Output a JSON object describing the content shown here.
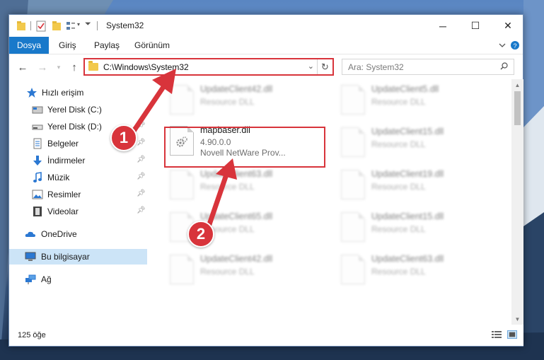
{
  "window": {
    "title": "System32",
    "controls": {
      "minimize": "─",
      "maximize": "☐",
      "close": "✕"
    }
  },
  "ribbon": {
    "tabs": [
      "Dosya",
      "Giriş",
      "Paylaş",
      "Görünüm"
    ],
    "expand_icon": "chevron-down-icon",
    "help_icon": "help-icon"
  },
  "address_bar": {
    "path": "C:\\Windows\\System32",
    "search_placeholder": "Ara: System32"
  },
  "sidebar": {
    "items": [
      {
        "label": "Hızlı erişim",
        "icon": "star-icon",
        "pinned": false
      },
      {
        "label": "Yerel Disk (C:)",
        "icon": "drive-icon",
        "pinned": false
      },
      {
        "label": "Yerel Disk (D:)",
        "icon": "drive-icon",
        "pinned": true
      },
      {
        "label": "Belgeler",
        "icon": "documents-icon",
        "pinned": true
      },
      {
        "label": "İndirmeler",
        "icon": "download-icon",
        "pinned": true
      },
      {
        "label": "Müzik",
        "icon": "music-icon",
        "pinned": true
      },
      {
        "label": "Resimler",
        "icon": "pictures-icon",
        "pinned": true
      },
      {
        "label": "Videolar",
        "icon": "video-icon",
        "pinned": true
      },
      {
        "label": "OneDrive",
        "icon": "cloud-icon",
        "pinned": false
      },
      {
        "label": "Bu bilgisayar",
        "icon": "computer-icon",
        "pinned": false,
        "selected": true
      },
      {
        "label": "Ağ",
        "icon": "network-icon",
        "pinned": false
      }
    ]
  },
  "files": {
    "highlighted": {
      "name": "mapbaser.dll",
      "version": "4.90.0.0",
      "description": "Novell NetWare Prov..."
    },
    "left_column": [
      {
        "name": "UpdateClient42.dll",
        "type": "Resource DLL"
      },
      {
        "name": "UpdateClient63.dll",
        "type": "Resource DLL"
      },
      {
        "name": "UpdateClient65.dll",
        "type": "Resource DLL"
      },
      {
        "name": "UpdateClient42.dll",
        "type": "Resource DLL"
      }
    ],
    "right_column": [
      {
        "name": "UpdateClient5.dll",
        "type": "Resource DLL"
      },
      {
        "name": "UpdateClient15.dll",
        "type": "Resource DLL"
      },
      {
        "name": "UpdateClient19.dll",
        "type": "Resource DLL"
      },
      {
        "name": "UpdateClient15.dll",
        "type": "Resource DLL"
      },
      {
        "name": "UpdateClient63.dll",
        "type": "Resource DLL"
      }
    ]
  },
  "status": {
    "item_count": "125 öğe"
  },
  "callouts": {
    "step1": "1",
    "step2": "2"
  },
  "colors": {
    "accent": "#1979ca",
    "highlight": "#d8343b",
    "selected_bg": "#cce4f7"
  }
}
